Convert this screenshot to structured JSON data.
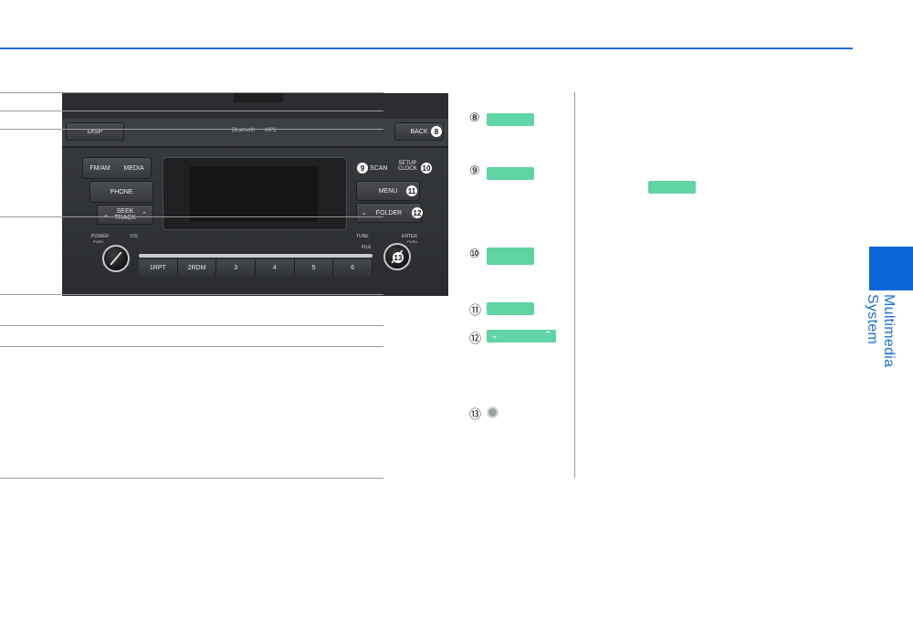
{
  "side": {
    "section_title": "Multimedia System"
  },
  "panel": {
    "buttons": {
      "disp": "DISP",
      "back": "BACK",
      "fm_am": "FM/AM",
      "media": "MEDIA",
      "phone": "PHONE",
      "seek": "SEEK",
      "track": "TRACK",
      "scan": "SCAN",
      "setup": "SETUP",
      "clock": "CLOCK",
      "menu": "MENU",
      "folder": "FOLDER"
    },
    "indicators": {
      "bluetooth": "Bluetooth",
      "mp3": "MP3"
    },
    "knob_labels": {
      "power": "POWER",
      "push": "PUSH",
      "vol": "VOL",
      "tune": "TUNE",
      "enter": "ENTER",
      "file": "FILE"
    },
    "presets": [
      "1RPT",
      "2RDM",
      "3",
      "4",
      "5",
      "6"
    ],
    "callouts": [
      "8",
      "9",
      "10",
      "11",
      "12",
      "13"
    ]
  },
  "table": {
    "rows": [
      {
        "num": "⑧"
      },
      {
        "num": "⑨"
      },
      {
        "num": "⑩"
      },
      {
        "num": "⑪"
      },
      {
        "num": "⑫"
      },
      {
        "num": "⑬"
      }
    ]
  },
  "colors": {
    "accent_blue": "#1a6fd8",
    "highlight_green": "#5fd4a5"
  },
  "icons": {
    "chevron_down": "chevron-down-icon",
    "chevron_up": "chevron-up-icon",
    "knob": "knob-icon"
  }
}
